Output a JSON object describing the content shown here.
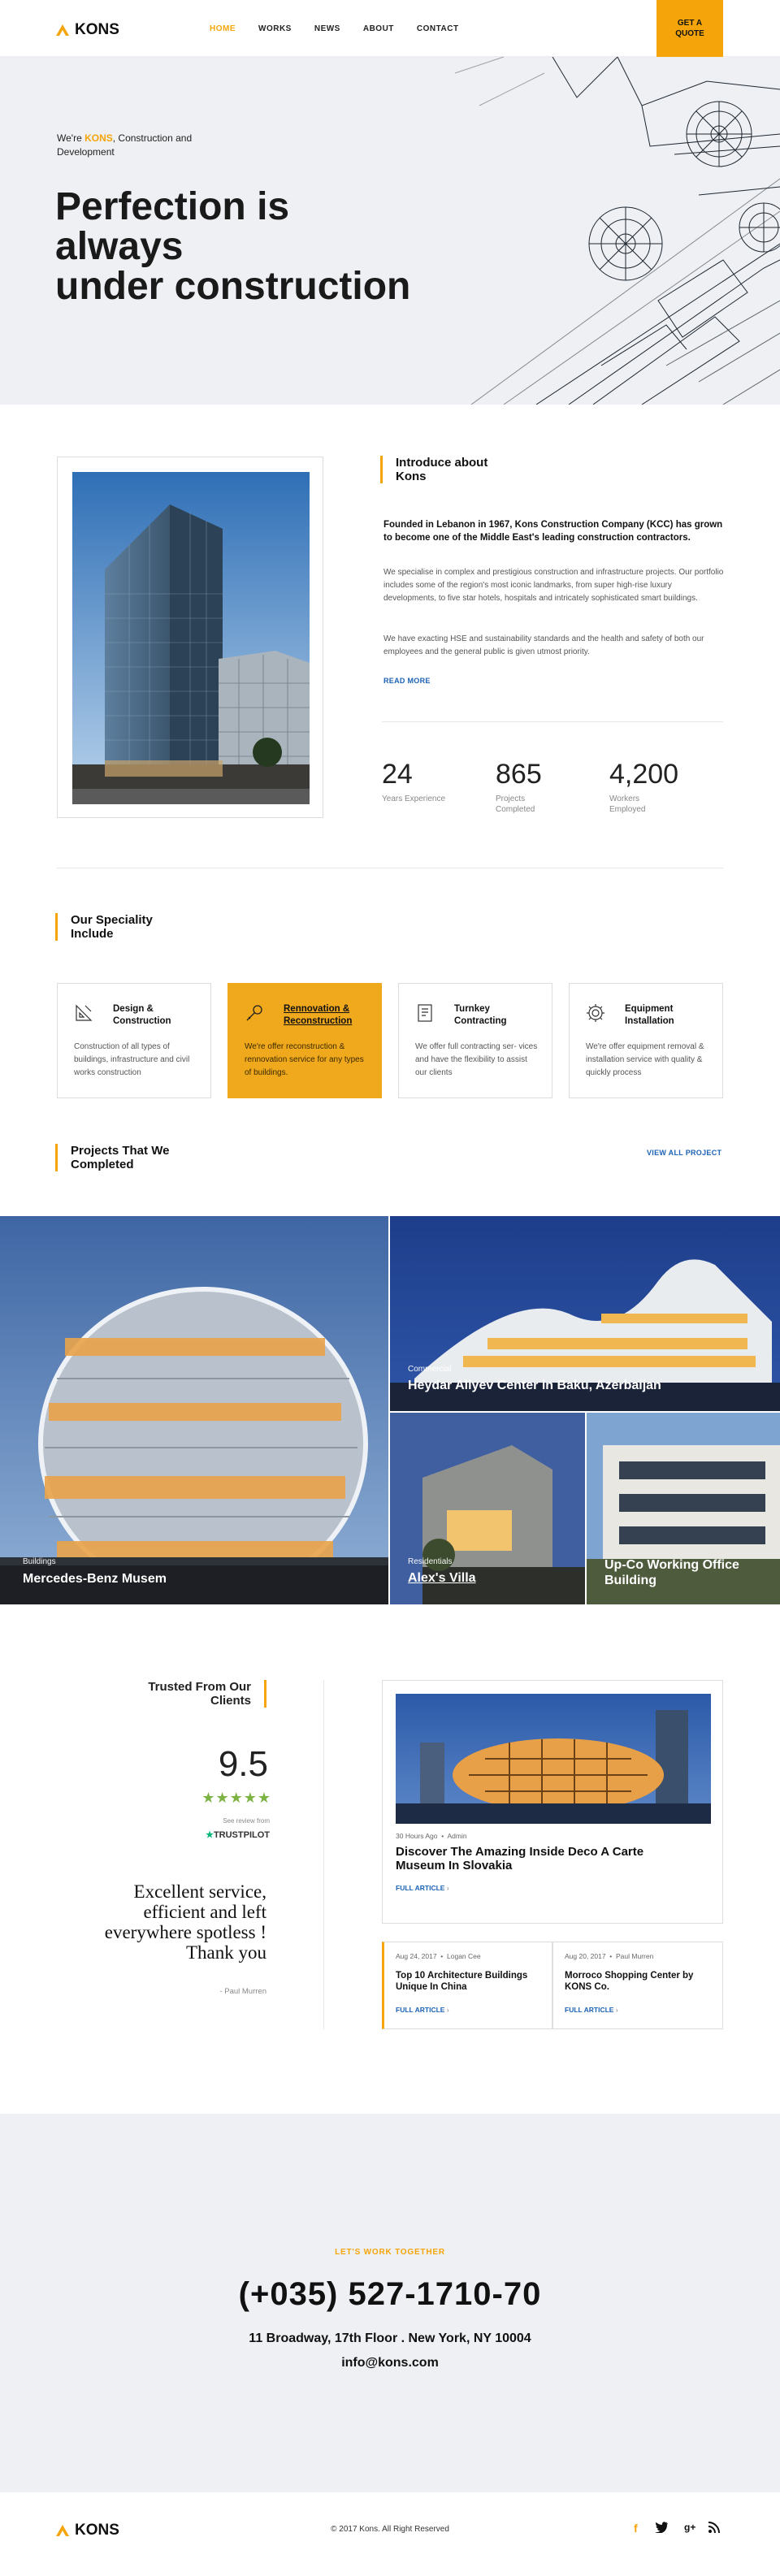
{
  "header": {
    "logo": "KONS",
    "nav": [
      "HOME",
      "WORKS",
      "NEWS",
      "ABOUT",
      "CONTACT"
    ],
    "quote_button": "GET A QUOTE"
  },
  "hero": {
    "sub_prefix": "We're ",
    "sub_brand": "KONS",
    "sub_suffix": ", Construction and Development",
    "title_line1": "Perfection is",
    "title_line2": "always",
    "title_line3": "under construction"
  },
  "intro": {
    "heading_line1": "Introduce about",
    "heading_line2": "Kons",
    "lead": "Founded in Lebanon in 1967, Kons Construction Company (KCC) has grown to become one of the Middle East's leading construction contractors.",
    "p1": "We specialise in complex and prestigious construction and infrastructure projects. Our portfolio includes some of the region's most iconic landmarks, from super high-rise luxury developments, to  five star hotels, hospitals and intricately sophisticated smart buildings.",
    "p2": "We have exacting  HSE and sustainability standards and the health and safety of both our employees and the general public is given utmost priority.",
    "read_more": "READ MORE",
    "stats": [
      {
        "value": "24",
        "label": "Years Experience"
      },
      {
        "value": "865",
        "label": "Projects Completed"
      },
      {
        "value": "4,200",
        "label": "Workers Employed"
      }
    ]
  },
  "specialty": {
    "heading_line1": "Our Speciality",
    "heading_line2": "Include",
    "cards": [
      {
        "title1": "Design &",
        "title2": "Construction",
        "desc": "Construction of all types of buildings, infrastructure and civil works construction",
        "icon": "design-icon"
      },
      {
        "title1": "Rennovation &",
        "title2": "Reconstruction",
        "desc": "We're offer reconstruction & rennovation service for any types of buildings.",
        "icon": "wrench-icon"
      },
      {
        "title1": "Turnkey",
        "title2": "Contracting",
        "desc": "We offer  full contracting ser- vices and have the flexibility to assist our clients",
        "icon": "document-icon"
      },
      {
        "title1": "Equipment",
        "title2": "Installation",
        "desc": "We're offer equipment removal & installation service with quality & quickly process",
        "icon": "gear-icon"
      }
    ]
  },
  "projects": {
    "heading_line1": "Projects That We",
    "heading_line2": "Completed",
    "view_all": "VIEW ALL PROJECT",
    "items": [
      {
        "category": "Buildings",
        "title": "Mercedes-Benz Musem"
      },
      {
        "category": "Commercial",
        "title": "Heydar Aliyev Center in Baku, Azerbaijan"
      },
      {
        "category": "Residentials",
        "title": "Alex's Villa"
      },
      {
        "category": "",
        "title": "Up-Co Working Office Building"
      }
    ]
  },
  "trusted": {
    "heading_line1": "Trusted From Our",
    "heading_line2": "Clients",
    "rating": "9.5",
    "stars": "★★★★★",
    "see_review": "See review from",
    "trustpilot": "TRUSTPILOT",
    "quote": "Excellent service, efficient and left everywhere spotless ! Thank you",
    "author": "- Paul Murren"
  },
  "blog": {
    "main": {
      "time": "30 Hours Ago",
      "author": "Admin",
      "title": "Discover The Amazing Inside Deco A Carte Museum In Slovakia",
      "link": "FULL ARTICLE"
    },
    "small": [
      {
        "date": "Aug 24, 2017",
        "author": "Logan Cee",
        "title": "Top 10 Architecture Buildings Unique In China",
        "link": "FULL ARTICLE"
      },
      {
        "date": "Aug 20, 2017",
        "author": "Paul Murren",
        "title": "Morroco Shopping Center by KONS Co.",
        "link": "FULL ARTICLE"
      }
    ]
  },
  "contact": {
    "tagline": "LET'S WORK TOGETHER",
    "phone": "(+035) 527-1710-70",
    "address": "11 Broadway, 17th Floor . New York, NY 10004",
    "email": "info@kons.com"
  },
  "footer": {
    "logo": "KONS",
    "copyright": "© 2017 Kons. All Right Reserved",
    "social": [
      "f",
      "t",
      "g+",
      "rss"
    ]
  },
  "colors": {
    "accent": "#f5a50a",
    "link": "#1b62b5"
  }
}
